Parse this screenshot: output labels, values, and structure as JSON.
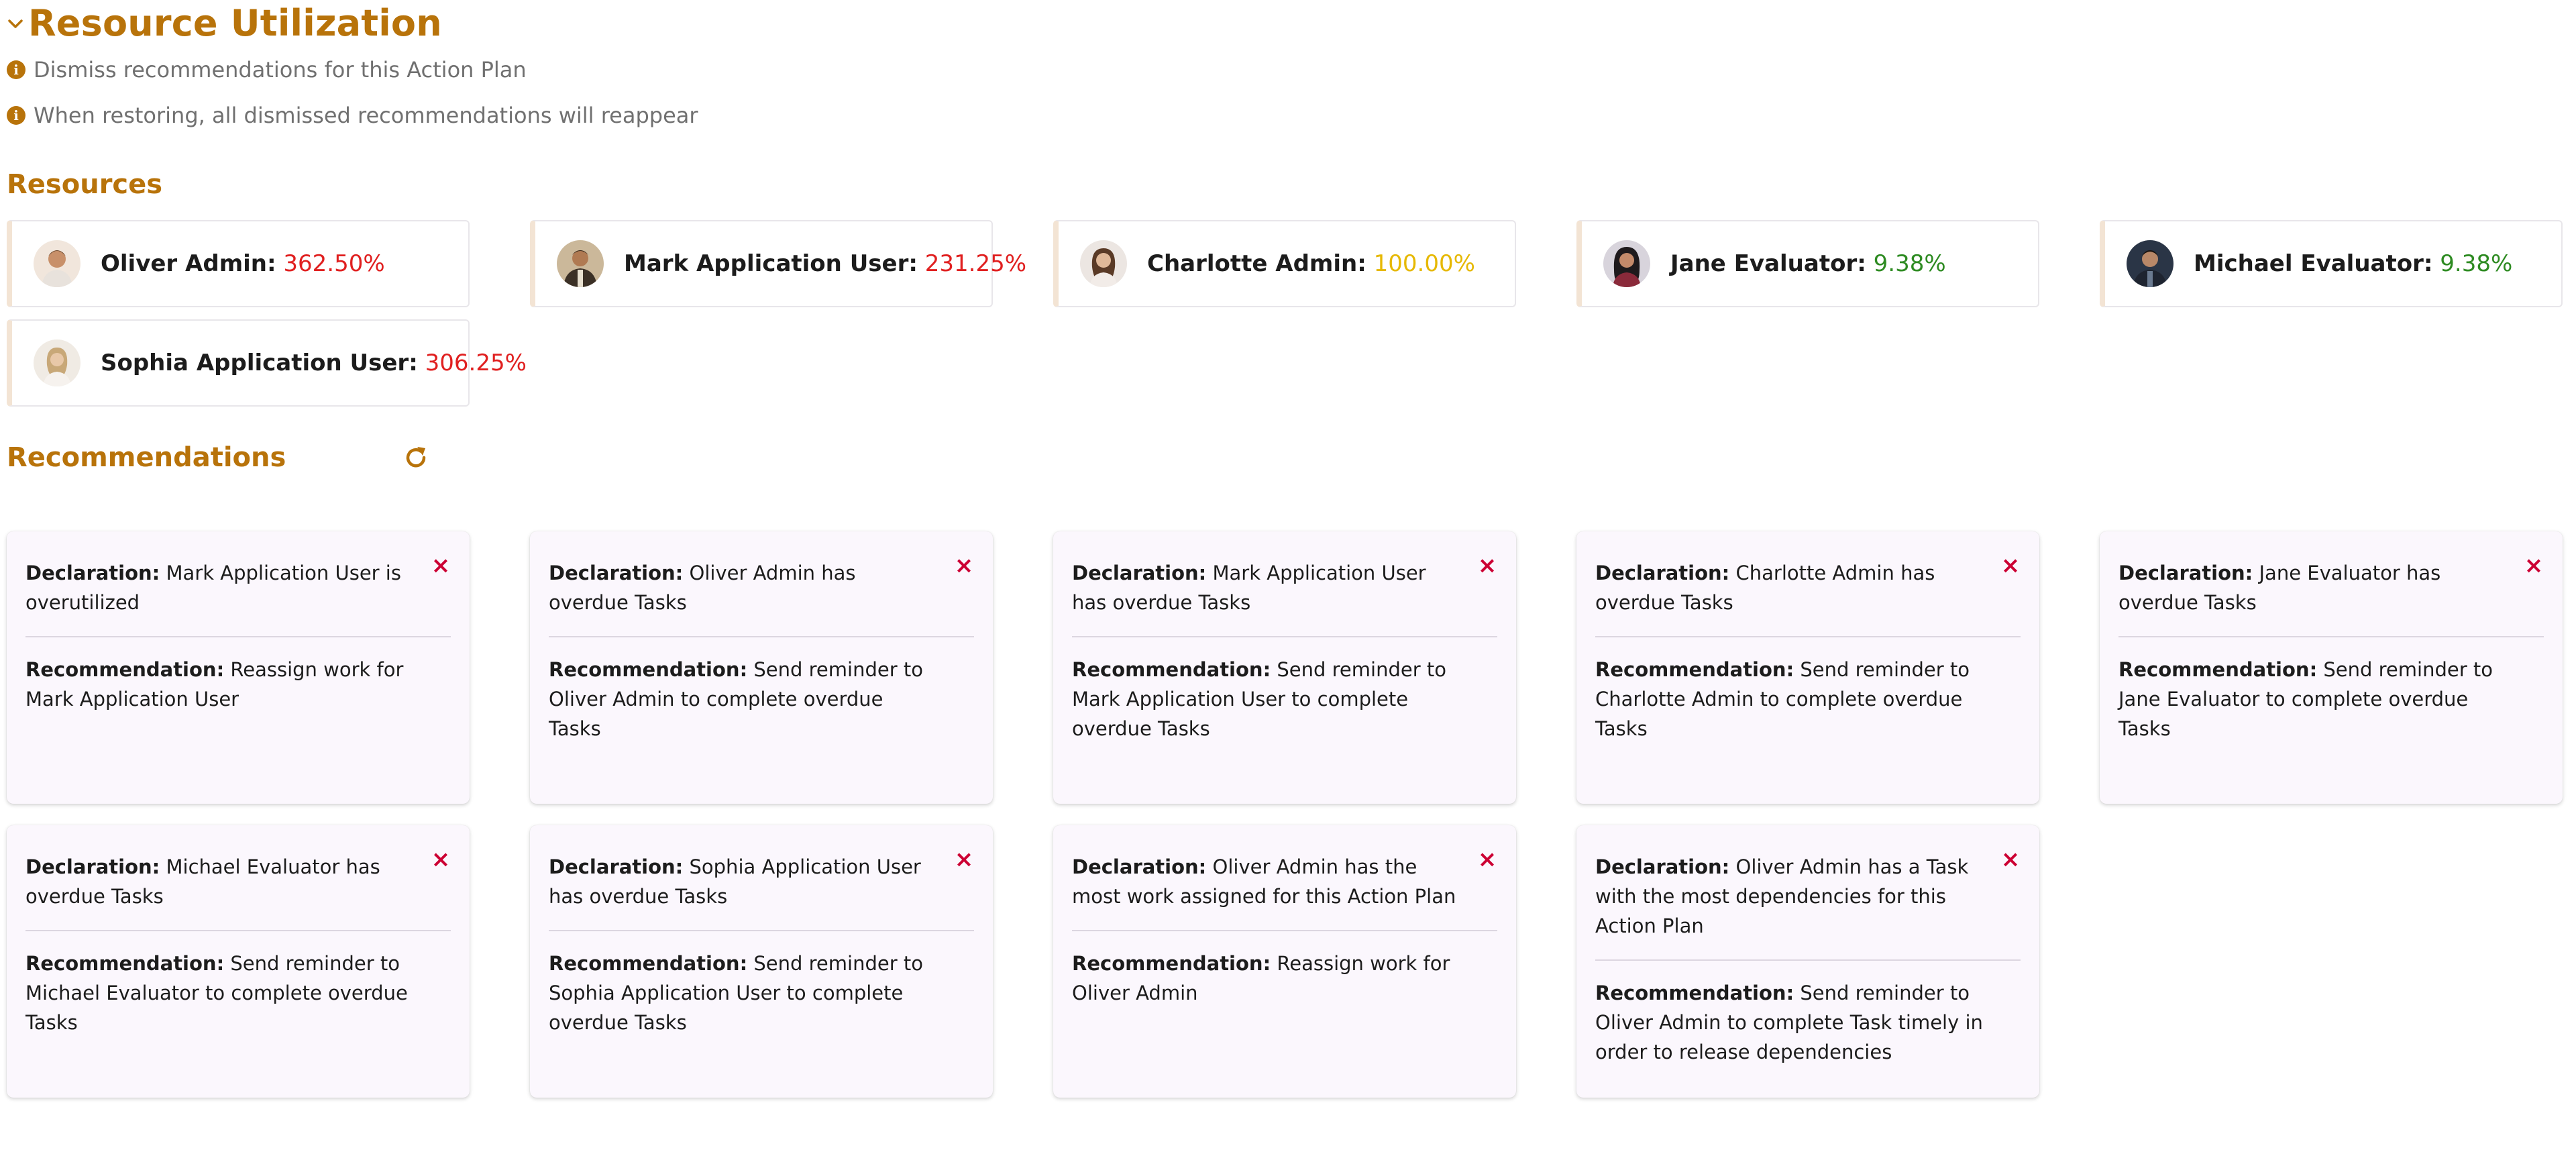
{
  "header": {
    "title": "Resource Utilization"
  },
  "info": [
    "Dismiss recommendations for this Action Plan",
    "When restoring, all dismissed recommendations will reappear"
  ],
  "resources": {
    "title": "Resources",
    "items": [
      {
        "name": "Oliver Admin:",
        "percent": "362.50%",
        "color": "#e02020"
      },
      {
        "name": "Mark Application User:",
        "percent": "231.25%",
        "color": "#e02020"
      },
      {
        "name": "Charlotte Admin:",
        "percent": "100.00%",
        "color": "#e6b800"
      },
      {
        "name": "Jane Evaluator:",
        "percent": "9.38%",
        "color": "#2e8b22"
      },
      {
        "name": "Michael Evaluator:",
        "percent": "9.38%",
        "color": "#2e8b22"
      },
      {
        "name": "Sophia Application User:",
        "percent": "306.25%",
        "color": "#e02020"
      }
    ]
  },
  "recommendations": {
    "title": "Recommendations",
    "declaration_label": "Declaration:",
    "recommendation_label": "Recommendation:",
    "close_glyph": "×",
    "items": [
      {
        "declaration": "Mark Application User is overutilized",
        "recommendation": "Reassign work for Mark Application User"
      },
      {
        "declaration": "Oliver Admin has overdue Tasks",
        "recommendation": "Send reminder to Oliver Admin to complete overdue Tasks"
      },
      {
        "declaration": "Mark Application User has overdue Tasks",
        "recommendation": "Send reminder to Mark Application User to complete overdue Tasks"
      },
      {
        "declaration": "Charlotte Admin has overdue Tasks",
        "recommendation": "Send reminder to Charlotte Admin to complete overdue Tasks"
      },
      {
        "declaration": "Jane Evaluator has overdue Tasks",
        "recommendation": "Send reminder to Jane Evaluator to complete overdue Tasks"
      },
      {
        "declaration": "Michael Evaluator has overdue Tasks",
        "recommendation": "Send reminder to Michael Evaluator to complete overdue Tasks"
      },
      {
        "declaration": "Sophia Application User has overdue Tasks",
        "recommendation": "Send reminder to Sophia Application User to complete overdue Tasks"
      },
      {
        "declaration": "Oliver Admin has the most work assigned for this Action Plan",
        "recommendation": "Reassign work for Oliver Admin"
      },
      {
        "declaration": "Oliver Admin has a Task with the most dependencies for this Action Plan",
        "recommendation": "Send reminder to Oliver Admin to complete Task timely in order to release dependencies"
      }
    ]
  },
  "colors": {
    "accent": "#b8730a",
    "danger": "#e02020",
    "warning": "#e6b800",
    "success": "#2e8b22",
    "close": "#cc0033"
  },
  "icons": {
    "collapse": "chevron-down-icon",
    "info": "info-icon",
    "refresh": "refresh-icon",
    "close": "close-icon"
  }
}
